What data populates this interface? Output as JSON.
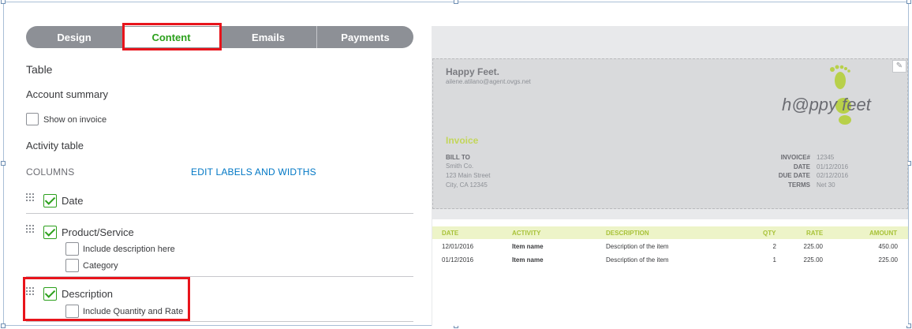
{
  "tabs": [
    {
      "label": "Design"
    },
    {
      "label": "Content"
    },
    {
      "label": "Emails"
    },
    {
      "label": "Payments"
    }
  ],
  "left": {
    "table_heading": "Table",
    "account_summary": "Account summary",
    "show_on_invoice": "Show on invoice",
    "activity_table": "Activity table",
    "columns_label": "COLUMNS",
    "edit_labels_link": "EDIT LABELS AND WIDTHS",
    "rows": {
      "date": "Date",
      "product_service": "Product/Service",
      "include_description": "Include description here",
      "category": "Category",
      "description": "Description",
      "include_qty_rate": "Include Quantity and Rate"
    },
    "checked": {
      "show_on_invoice": false,
      "date": true,
      "product_service": true,
      "include_description": false,
      "category": false,
      "description": true,
      "include_qty_rate": false
    }
  },
  "preview": {
    "company": "Happy Feet.",
    "email": "ailene.atilano@agent.ovgs.net",
    "logo_text": "h@ppy feet",
    "title": "Invoice",
    "bill_to_label": "BILL TO",
    "bill_to": [
      "Smith Co.",
      "123 Main Street",
      "City, CA 12345"
    ],
    "meta": [
      {
        "label": "INVOICE#",
        "value": "12345"
      },
      {
        "label": "DATE",
        "value": "01/12/2016"
      },
      {
        "label": "DUE DATE",
        "value": "02/12/2016"
      },
      {
        "label": "TERMS",
        "value": "Net 30"
      }
    ],
    "table_headers": {
      "date": "DATE",
      "activity": "ACTIVITY",
      "description": "DESCRIPTION",
      "qty": "QTY",
      "rate": "RATE",
      "amount": "AMOUNT"
    },
    "rows": [
      {
        "date": "12/01/2016",
        "activity": "Item name",
        "description": "Description of the item",
        "qty": "2",
        "rate": "225.00",
        "amount": "450.00"
      },
      {
        "date": "01/12/2016",
        "activity": "Item name",
        "description": "Description of the item",
        "qty": "1",
        "rate": "225.00",
        "amount": "225.00"
      }
    ]
  },
  "colors": {
    "accent_green": "#2ca01c",
    "link_blue": "#0077c5",
    "highlight_red": "#e8141b",
    "invoice_lime": "#c3d65a"
  },
  "icons": [
    "drag-handle-icon",
    "checkmark-icon",
    "pencil-icon"
  ]
}
